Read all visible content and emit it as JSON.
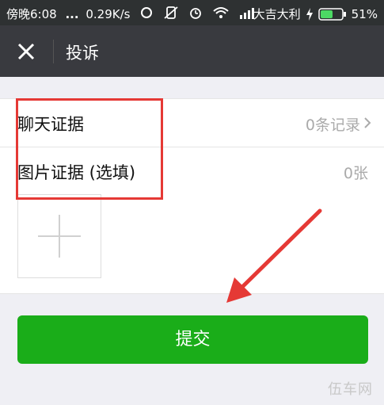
{
  "status_bar": {
    "time": "傍晚6:08",
    "dots": "...",
    "speed": "0.29K/s",
    "carrier": "大吉大利",
    "battery": "51%"
  },
  "header": {
    "title": "投诉"
  },
  "form": {
    "chat_evidence": {
      "label": "聊天证据",
      "value": "0条记录"
    },
    "image_evidence": {
      "label": "图片证据 (选填)",
      "value": "0张"
    }
  },
  "submit_label": "提交",
  "watermark": "伍车网",
  "colors": {
    "header_bg": "#393a3f",
    "submit_green": "#1aad19",
    "highlight_red": "#e53935"
  }
}
